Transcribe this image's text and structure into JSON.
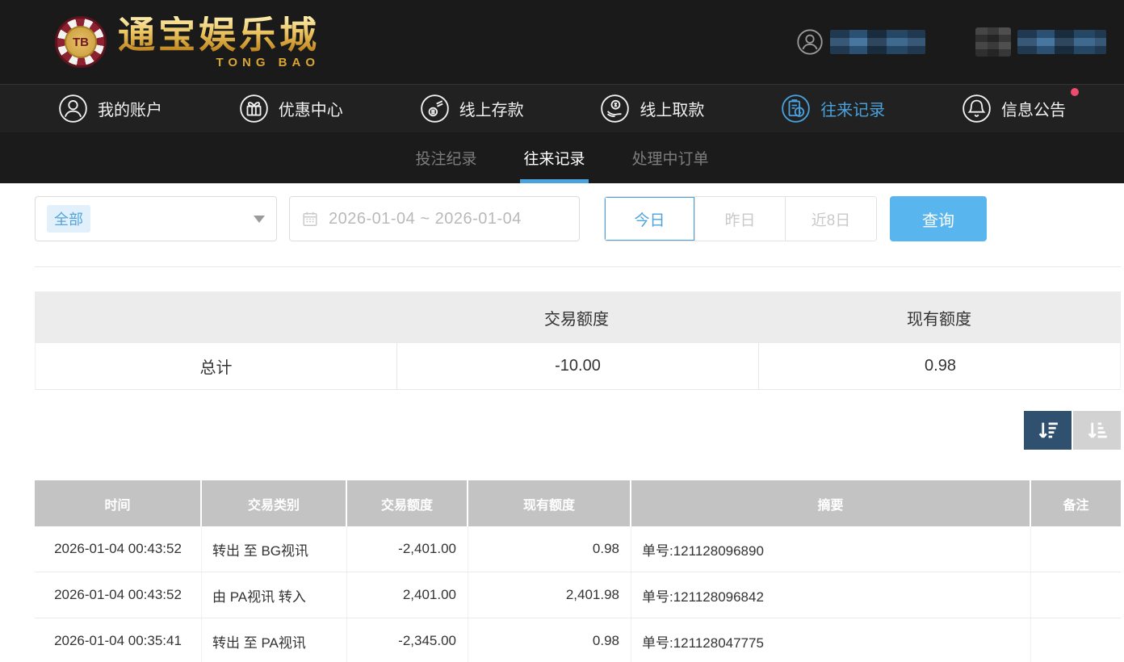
{
  "brand": {
    "chip": "TB",
    "name": "通宝娱乐城",
    "name_en": "TONG BAO"
  },
  "nav": {
    "items": [
      {
        "label": "我的账户",
        "icon": "account-icon",
        "active": false
      },
      {
        "label": "优惠中心",
        "icon": "promotions-icon",
        "active": false
      },
      {
        "label": "线上存款",
        "icon": "deposit-icon",
        "active": false
      },
      {
        "label": "线上取款",
        "icon": "withdraw-icon",
        "active": false
      },
      {
        "label": "往来记录",
        "icon": "records-icon",
        "active": true
      },
      {
        "label": "信息公告",
        "icon": "announcements-icon",
        "active": false,
        "notification_dot": true
      }
    ]
  },
  "subnav": {
    "tabs": [
      {
        "label": "投注纪录",
        "active": false
      },
      {
        "label": "往来记录",
        "active": true
      },
      {
        "label": "处理中订单",
        "active": false
      }
    ]
  },
  "filters": {
    "category_selected": "全部",
    "date_range": "2026-01-04 ~ 2026-01-04",
    "quick_ranges": [
      {
        "label": "今日",
        "active": true
      },
      {
        "label": "昨日",
        "active": false
      },
      {
        "label": "近8日",
        "active": false
      }
    ],
    "query_label": "查询"
  },
  "summary": {
    "headers": [
      "",
      "交易额度",
      "现有额度"
    ],
    "total_label": "总计",
    "transaction_total": "-10.00",
    "balance_total": "0.98"
  },
  "sort": {
    "desc_icon": "sort-amount-desc",
    "asc_icon": "sort-amount-asc"
  },
  "table": {
    "headers": [
      "时间",
      "交易类别",
      "交易额度",
      "现有额度",
      "摘要",
      "备注"
    ],
    "rows": [
      [
        "2026-01-04 00:43:52",
        "转出 至 BG视讯",
        "-2,401.00",
        "0.98",
        "单号:121128096890",
        ""
      ],
      [
        "2026-01-04 00:43:52",
        "由 PA视讯 转入",
        "2,401.00",
        "2,401.98",
        "单号:121128096842",
        ""
      ],
      [
        "2026-01-04 00:35:41",
        "转出 至 PA视讯",
        "-2,345.00",
        "0.98",
        "单号:121128047775",
        ""
      ]
    ]
  },
  "colors": {
    "accent_blue": "#4aa0dc",
    "button_blue": "#58b5ee",
    "header_bg": "#1a1a1a",
    "table_header_gray": "#c3c3c3",
    "sort_active_bg": "#30506f",
    "notification_red": "#ee4b6e",
    "gold": "#d8a634"
  }
}
